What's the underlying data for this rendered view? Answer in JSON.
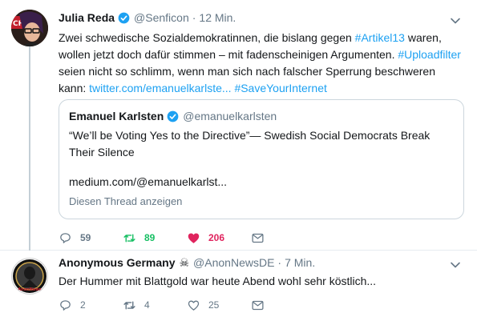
{
  "colors": {
    "link": "#1da1f2",
    "retweeted": "#17bf63",
    "liked": "#e0245e",
    "muted": "#657786",
    "border": "#e6ecf0"
  },
  "tweets": [
    {
      "author_name": "Julia Reda",
      "verified": true,
      "handle": "@Senficon",
      "separator": "·",
      "time": "12 Min.",
      "text_parts": {
        "p1": "Zwei schwedische Sozialdemokratinnen, die bislang gegen ",
        "tag1": "#Artikel13",
        "p2": " waren, wollen jetzt doch dafür stimmen – mit fadenscheinigen Argumenten. ",
        "tag2": "#Uploadfilter",
        "p3": " seien nicht so schlimm, wenn man sich nach falscher Sperrung beschweren kann: ",
        "link": "twitter.com/emanuelkarlste...",
        "space": " ",
        "tag3": "#SaveYourInternet"
      },
      "quote": {
        "author_name": "Emanuel Karlsten",
        "verified": true,
        "handle": "@emanuelkarlsten",
        "text": "“We’ll be Voting Yes to the Directive”— Swedish Social Democrats Break Their Silence",
        "url": "medium.com/@emanuelkarlst...",
        "thread_label": "Diesen Thread anzeigen"
      },
      "actions": {
        "replies": "59",
        "retweets": "89",
        "likes": "206"
      },
      "icons": [
        "reply-icon",
        "retweet-icon",
        "heart-filled-icon",
        "message-icon",
        "verified-icon",
        "caret-down-icon"
      ]
    },
    {
      "author_name": "Anonymous Germany",
      "badge": "☠",
      "handle": "@AnonNewsDE",
      "separator": "·",
      "time": "7 Min.",
      "text": "Der Hummer mit Blattgold war heute Abend wohl sehr köstlich...",
      "actions": {
        "replies": "2",
        "retweets": "4",
        "likes": "25"
      },
      "avatar_label": "AnonNews",
      "icons": [
        "reply-icon",
        "retweet-icon",
        "heart-icon",
        "message-icon",
        "skull-flag-icon",
        "caret-down-icon"
      ]
    }
  ]
}
